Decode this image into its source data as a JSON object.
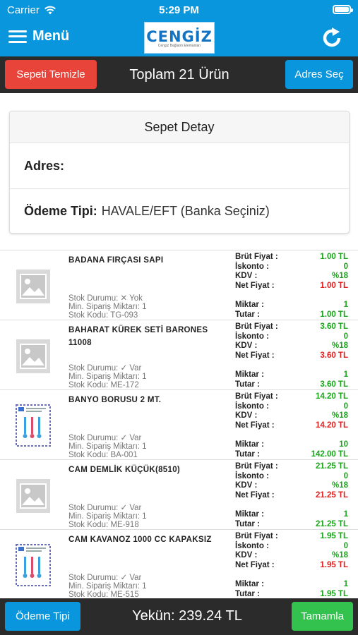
{
  "status": {
    "carrier": "Carrier",
    "time": "5:29 PM"
  },
  "header": {
    "menu_label": "Menü",
    "logo_text": "CENGİZ",
    "logo_tagline": "Cengiz Bağlantı Elemanları"
  },
  "toolbar": {
    "clear_cart": "Sepeti Temizle",
    "title": "Toplam 21 Ürün",
    "select_address": "Adres Seç"
  },
  "detail": {
    "title": "Sepet Detay",
    "address_label": "Adres:",
    "address_value": "",
    "payment_label": "Ödeme Tipi:",
    "payment_value": "HAVALE/EFT (Banka Seçiniz)"
  },
  "labels": {
    "brut": "Brüt Fiyat :",
    "iskonto": "İskonto :",
    "kdv": "KDV :",
    "net": "Net Fiyat :",
    "miktar": "Miktar :",
    "tutar": "Tutar :"
  },
  "items": [
    {
      "name": "BADANA FIRÇASI SAPI",
      "stock": "Stok Durumu: ✕ Yok",
      "min": "Min. Sipariş Miktarı: 1",
      "code": "Stok Kodu: TG-093",
      "image": "placeholder",
      "brut": "1.00 TL",
      "iskonto": "0",
      "kdv": "%18",
      "net": "1.00 TL",
      "miktar": "1",
      "tutar": "1.00 TL"
    },
    {
      "name": "BAHARAT KÜREK SETİ BARONES 11008",
      "stock": "Stok Durumu: ✓ Var",
      "min": "Min. Sipariş Miktarı: 1",
      "code": "Stok Kodu: ME-172",
      "image": "placeholder",
      "brut": "3.60 TL",
      "iskonto": "0",
      "kdv": "%18",
      "net": "3.60 TL",
      "miktar": "1",
      "tutar": "3.60 TL"
    },
    {
      "name": "BANYO BORUSU 2 MT.",
      "stock": "Stok Durumu: ✓ Var",
      "min": "Min. Sipariş Miktarı: 1",
      "code": "Stok Kodu: BA-001",
      "image": "product-card",
      "brut": "14.20 TL",
      "iskonto": "0",
      "kdv": "%18",
      "net": "14.20 TL",
      "miktar": "10",
      "tutar": "142.00 TL"
    },
    {
      "name": "CAM DEMLİK KÜÇÜK(8510)",
      "stock": "Stok Durumu: ✓ Var",
      "min": "Min. Sipariş Miktarı: 1",
      "code": "Stok Kodu: ME-918",
      "image": "placeholder",
      "brut": "21.25 TL",
      "iskonto": "0",
      "kdv": "%18",
      "net": "21.25 TL",
      "miktar": "1",
      "tutar": "21.25 TL"
    },
    {
      "name": "CAM KAVANOZ 1000 CC KAPAKSIZ",
      "stock": "Stok Durumu: ✓ Var",
      "min": "Min. Sipariş Miktarı: 1",
      "code": "Stok Kodu: ME-515",
      "image": "product-card",
      "brut": "1.95 TL",
      "iskonto": "0",
      "kdv": "%18",
      "net": "1.95 TL",
      "miktar": "1",
      "tutar": "1.95 TL"
    }
  ],
  "footer": {
    "payment_type": "Ödeme Tipi",
    "total": "Yekün: 239.24 TL",
    "complete": "Tamamla"
  },
  "colors": {
    "primary": "#0a96dc",
    "danger": "#e8443a",
    "success": "#33c24d",
    "dark": "#2b2b2b",
    "price_green": "#1aa51a",
    "price_red": "#e02020"
  }
}
